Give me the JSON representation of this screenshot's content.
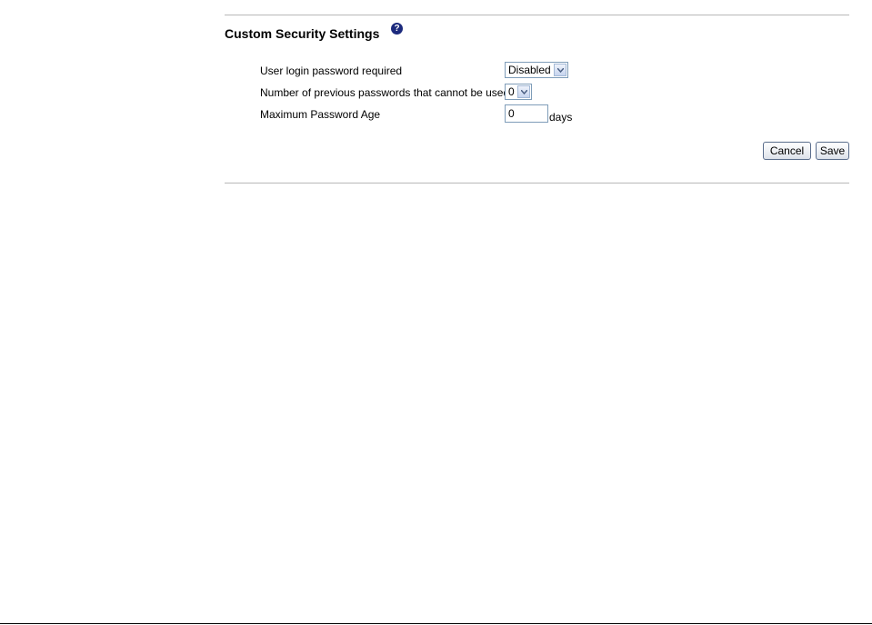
{
  "section": {
    "title": "Custom Security Settings",
    "help_icon_glyph": "?"
  },
  "fields": {
    "login_required": {
      "label": "User login password required",
      "selected": "Disabled"
    },
    "previous_passwords": {
      "label": "Number of previous passwords that cannot be used",
      "selected": "0"
    },
    "max_age": {
      "label": "Maximum Password Age",
      "value": "0",
      "unit": "days"
    }
  },
  "buttons": {
    "cancel": "Cancel",
    "save": "Save"
  },
  "colors": {
    "help_icon": "#1c2a7d",
    "rule": "#b8b8b8",
    "input_border": "#7f9db9"
  }
}
